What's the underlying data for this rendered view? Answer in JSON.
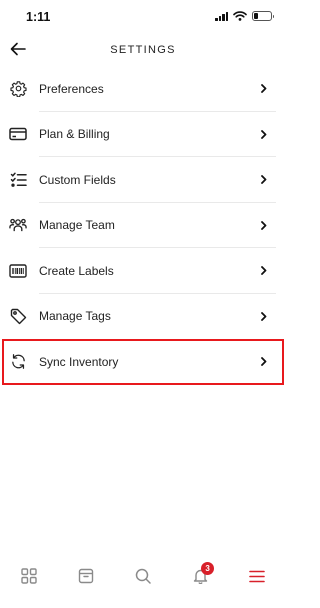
{
  "status_bar": {
    "time": "1:11"
  },
  "header": {
    "title": "SETTINGS",
    "back_icon": "arrow-left-icon"
  },
  "menu_items": [
    {
      "label": "Preferences",
      "icon": "gear-icon"
    },
    {
      "label": "Plan & Billing",
      "icon": "credit-card-icon"
    },
    {
      "label": "Custom Fields",
      "icon": "list-icon"
    },
    {
      "label": "Manage Team",
      "icon": "team-icon"
    },
    {
      "label": "Create Labels",
      "icon": "barcode-icon"
    },
    {
      "label": "Manage Tags",
      "icon": "tag-icon"
    },
    {
      "label": "Sync Inventory",
      "icon": "sync-icon"
    }
  ],
  "highlight_color": "#e8191d",
  "tab_bar": {
    "tabs": [
      {
        "icon": "dashboard-icon"
      },
      {
        "icon": "inventory-box-icon"
      },
      {
        "icon": "search-icon"
      },
      {
        "icon": "bell-icon",
        "badge": "3"
      },
      {
        "icon": "hamburger-menu-icon",
        "active": true
      }
    ],
    "active_color": "#d8202a",
    "inactive_color": "#8a8a8a"
  }
}
